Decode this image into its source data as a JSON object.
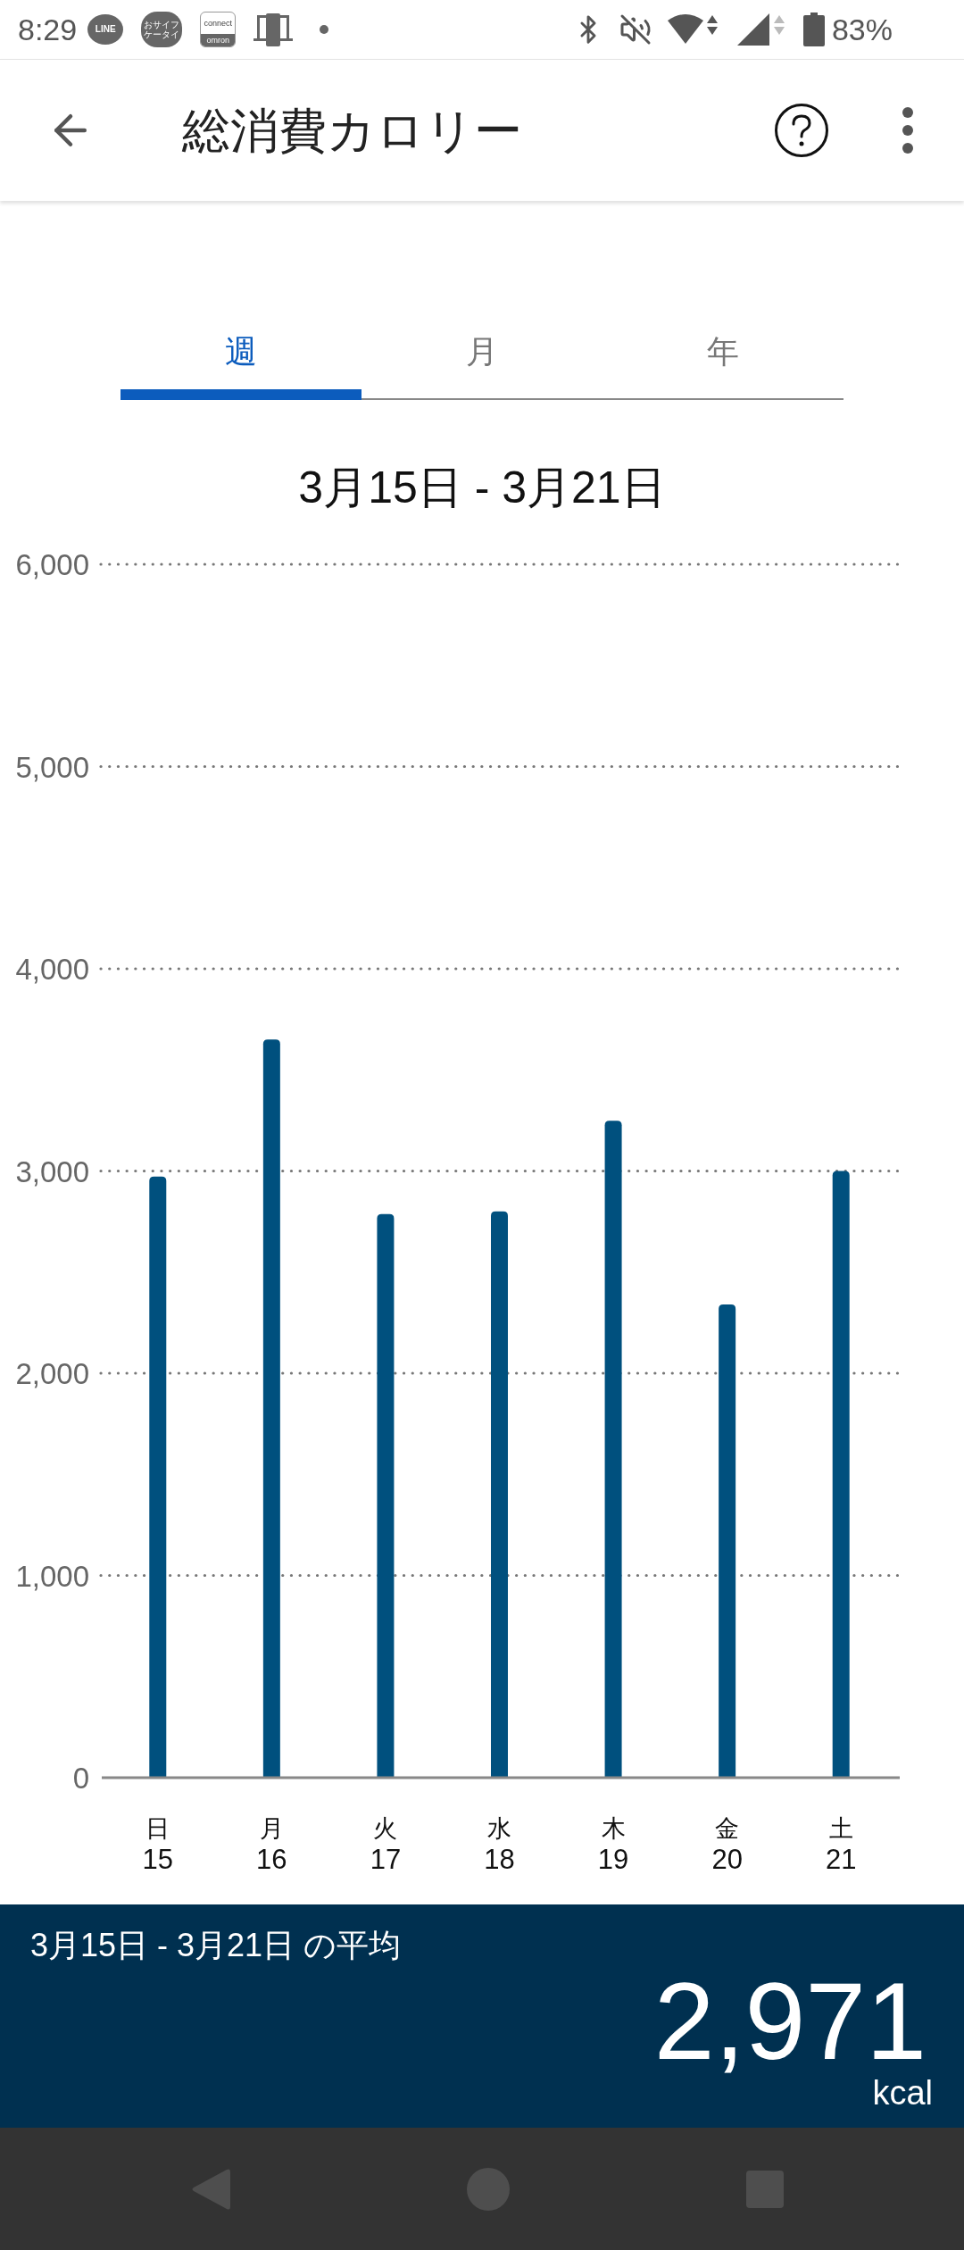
{
  "status_bar": {
    "time": "8:29",
    "notifications": [
      {
        "kind": "chat",
        "label": "LINE"
      },
      {
        "kind": "wallet",
        "lines": [
          "おサイフ",
          "ケータイ"
        ]
      },
      {
        "kind": "connect",
        "label": "connect",
        "sublabel": "omron"
      },
      {
        "kind": "device"
      },
      {
        "kind": "dot"
      }
    ],
    "battery": "83%"
  },
  "header": {
    "title": "総消費カロリー"
  },
  "tabs": [
    {
      "label": "週",
      "selected": true
    },
    {
      "label": "月",
      "selected": false
    },
    {
      "label": "年",
      "selected": false
    }
  ],
  "period_title": "3月15日 - 3月21日",
  "chart": {
    "weekdays": [
      "日",
      "月",
      "火",
      "水",
      "木",
      "金",
      "土"
    ],
    "chart_data": {
      "type": "bar",
      "grid": true,
      "categories": [
        "15",
        "16",
        "17",
        "18",
        "19",
        "20",
        "21"
      ],
      "values": [
        2972,
        3650,
        2787,
        2800,
        3248,
        2340,
        3000
      ],
      "ylim": [
        0,
        6000
      ],
      "yticks": [
        {
          "value": 0,
          "label": "0"
        },
        {
          "value": 1000,
          "label": "1,000"
        },
        {
          "value": 2000,
          "label": "2,000"
        },
        {
          "value": 3000,
          "label": "3,000"
        },
        {
          "value": 4000,
          "label": "4,000"
        },
        {
          "value": 5000,
          "label": "5,000"
        },
        {
          "value": 6000,
          "label": "6,000"
        }
      ]
    }
  },
  "summary": {
    "label": "3月15日 - 3月21日 の平均",
    "value": "2,971",
    "unit": "kcal"
  }
}
